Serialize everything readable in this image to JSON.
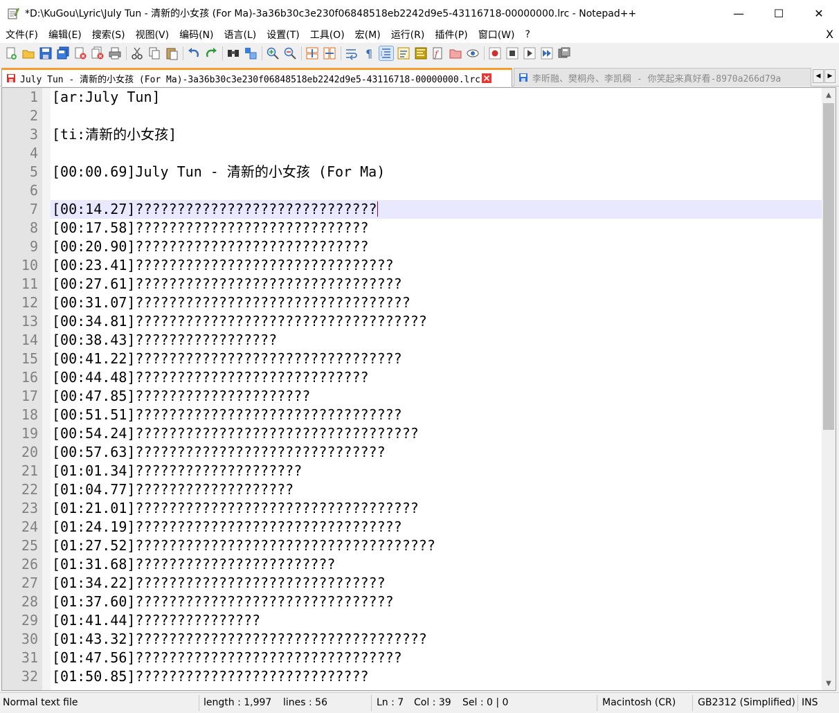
{
  "window": {
    "title": "*D:\\KuGou\\Lyric\\July Tun - 清新的小女孩 (For Ma)-3a36b30c3e230f06848518eb2242d9e5-43116718-00000000.lrc - Notepad++",
    "minimize": "—",
    "maximize": "☐",
    "close": "✕"
  },
  "menu": {
    "items": [
      "文件(F)",
      "编辑(E)",
      "搜索(S)",
      "视图(V)",
      "编码(N)",
      "语言(L)",
      "设置(T)",
      "工具(O)",
      "宏(M)",
      "运行(R)",
      "插件(P)",
      "窗口(W)",
      "?"
    ],
    "close": "X"
  },
  "toolbar": {
    "icons": [
      "new-file-icon",
      "open-file-icon",
      "save-icon",
      "save-all-icon",
      "close-icon",
      "close-all-icon",
      "print-icon",
      "cut-icon",
      "copy-icon",
      "paste-icon",
      "undo-icon",
      "redo-icon",
      "find-icon",
      "replace-icon",
      "zoom-in-icon",
      "zoom-out-icon",
      "sync-vertical-icon",
      "sync-horizontal-icon",
      "word-wrap-icon",
      "show-all-chars-icon",
      "indent-guide-icon",
      "function-list-icon",
      "document-map-icon",
      "doc-switcher-icon",
      "folder-workspace-icon",
      "monitoring-icon",
      "record-macro-icon",
      "stop-macro-icon",
      "play-macro-icon",
      "run-macro-multiple-icon",
      "save-macro-icon"
    ]
  },
  "tabs": {
    "active": "July Tun - 清新的小女孩 (For Ma)-3a36b30c3e230f06848518eb2242d9e5-43116718-00000000.lrc",
    "inactive": "李昕融、樊桐舟、李凯稠 - 你笑起来真好看-8970a266d79a",
    "nav_left": "◀",
    "nav_right": "▶"
  },
  "editor": {
    "current_line": 7,
    "lines": [
      "[ar:July Tun]",
      "",
      "[ti:清新的小女孩]",
      "",
      "[00:00.69]July Tun - 清新的小女孩 (For Ma)",
      "",
      "[00:14.27]?????????????????????????????",
      "[00:17.58]????????????????????????????",
      "[00:20.90]????????????????????????????",
      "[00:23.41]???????????????????????????????",
      "[00:27.61]????????????????????????????????",
      "[00:31.07]?????????????????????????????????",
      "[00:34.81]???????????????????????????????????",
      "[00:38.43]?????????????????",
      "[00:41.22]????????????????????????????????",
      "[00:44.48]????????????????????????????",
      "[00:47.85]?????????????????????",
      "[00:51.51]????????????????????????????????",
      "[00:54.24]??????????????????????????????????",
      "[00:57.63]??????????????????????????????",
      "[01:01.34]????????????????????",
      "[01:04.77]???????????????????",
      "[01:21.01]??????????????????????????????????",
      "[01:24.19]????????????????????????????????",
      "[01:27.52]????????????????????????????????????",
      "[01:31.68]????????????????????????",
      "[01:34.22]??????????????????????????????",
      "[01:37.60]???????????????????????????????",
      "[01:41.44]???????????????",
      "[01:43.32]???????????????????????????????????",
      "[01:47.56]????????????????????????????????",
      "[01:50.85]????????????????????????????"
    ]
  },
  "status": {
    "file_type": "Normal text file",
    "length": "length : 1,997",
    "lines": "lines : 56",
    "ln": "Ln : 7",
    "col": "Col : 39",
    "sel": "Sel : 0 | 0",
    "eol": "Macintosh (CR)",
    "encoding": "GB2312 (Simplified)",
    "mode": "INS"
  },
  "colors": {
    "accent_tab": "#f79b2c",
    "current_line": "#e8e8ff",
    "caret": "#800080"
  }
}
